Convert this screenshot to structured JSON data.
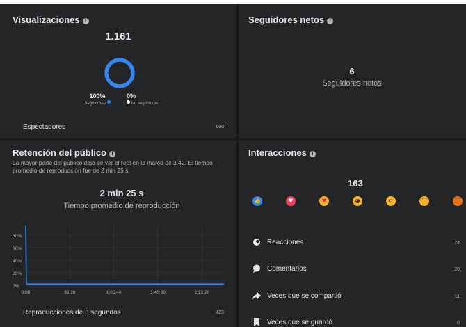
{
  "views": {
    "title": "Visualizaciones",
    "total": "1.161",
    "followers_pct": "100%",
    "non_followers_pct": "0%",
    "followers_label": "Seguidores",
    "non_followers_label": "No seguidores",
    "followers_fraction": 1.0,
    "viewers_label": "Espectadores",
    "viewers_value": "600",
    "colors": {
      "followers": "#2d88ff",
      "non_followers": "#ffffff"
    }
  },
  "net_followers": {
    "title": "Seguidores netos",
    "value": "6",
    "label": "Seguidores netos"
  },
  "retention": {
    "title": "Retención del público",
    "description": "La mayor parte del público dejó de ver el reel en la marca de 3:42. El tiempo promedio de reproducción fue de 2 min 25 s.",
    "avg_time": "2 min 25 s",
    "avg_label": "Tiempo promedio de reproducción",
    "plays_label": "Reproducciones de 3 segundos",
    "plays_value": "423"
  },
  "interactions": {
    "title": "Interacciones",
    "total": "163",
    "reaction_icons": [
      "like-icon",
      "love-icon",
      "care-icon",
      "haha-icon",
      "wow-icon",
      "sad-icon",
      "angry-icon"
    ],
    "rows": [
      {
        "label": "Reacciones",
        "value": "124",
        "icon": "reactions-icon"
      },
      {
        "label": "Comentarios",
        "value": "28",
        "icon": "comment-icon"
      },
      {
        "label": "Veces que se compartió",
        "value": "11",
        "icon": "share-icon"
      },
      {
        "label": "Veces que se guardó",
        "value": "0",
        "icon": "bookmark-icon"
      }
    ]
  },
  "chart_data": {
    "type": "line",
    "x": [
      "0:00",
      "0:30",
      "1:00",
      "2:00",
      "4:00",
      "6:00",
      "10:00",
      "20:00",
      "33:20",
      "50:00",
      "1:06:40",
      "1:20:00",
      "1:40:00",
      "2:00:00",
      "2:13:20",
      "2:30:00"
    ],
    "y": [
      95,
      3,
      2,
      2,
      2,
      2,
      2,
      2,
      2,
      2,
      2,
      2,
      2,
      2,
      2,
      2
    ],
    "x_ticks": [
      "0:00",
      "33:20",
      "1:06:40",
      "1:40:00",
      "2:13:20"
    ],
    "y_ticks": [
      "0%",
      "20%",
      "40%",
      "60%",
      "80%"
    ],
    "ylim": [
      0,
      100
    ],
    "grid": true,
    "color": "#2d88ff"
  }
}
